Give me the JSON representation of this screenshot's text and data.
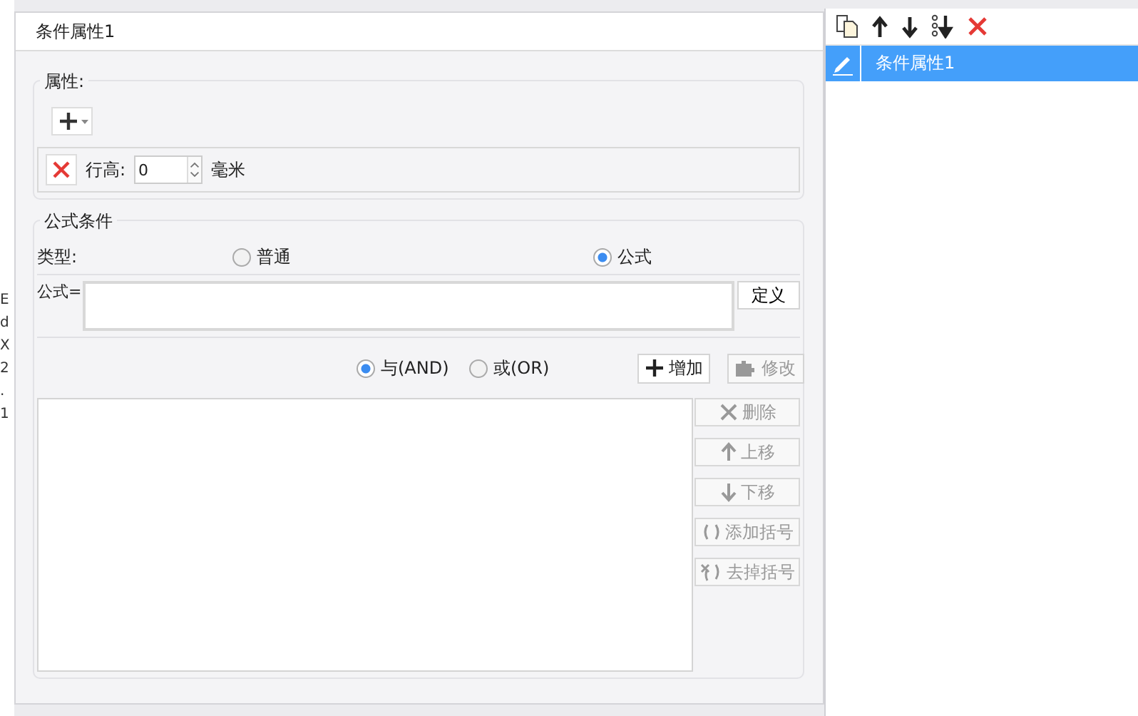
{
  "background_cells": [
    "E",
    "d",
    "X",
    "2",
    ".",
    "1"
  ],
  "dialog": {
    "title": "条件属性1"
  },
  "properties": {
    "legend": "属性:",
    "items": [
      {
        "label": "行高:",
        "value": "0",
        "unit": "毫米"
      }
    ]
  },
  "formula_condition": {
    "legend": "公式条件",
    "type_label": "类型:",
    "types": [
      {
        "label": "普通",
        "selected": false
      },
      {
        "label": "公式",
        "selected": true
      }
    ],
    "formula_label": "公式=",
    "define_button": "定义",
    "logic": [
      {
        "label": "与(AND)",
        "selected": true
      },
      {
        "label": "或(OR)",
        "selected": false
      }
    ],
    "actions": [
      {
        "kind": "add",
        "label": "增加",
        "disabled": false
      },
      {
        "kind": "edit",
        "label": "修改",
        "disabled": true
      }
    ],
    "side_actions": [
      {
        "kind": "delete",
        "label": "删除",
        "disabled": true
      },
      {
        "kind": "up",
        "label": "上移",
        "disabled": true
      },
      {
        "kind": "down",
        "label": "下移",
        "disabled": true
      },
      {
        "kind": "paren",
        "label": "添加括号",
        "disabled": true
      },
      {
        "kind": "unparen",
        "label": "去掉括号",
        "disabled": true
      }
    ]
  },
  "condition_list": {
    "items": [
      {
        "label": "条件属性1",
        "selected": true
      }
    ]
  }
}
